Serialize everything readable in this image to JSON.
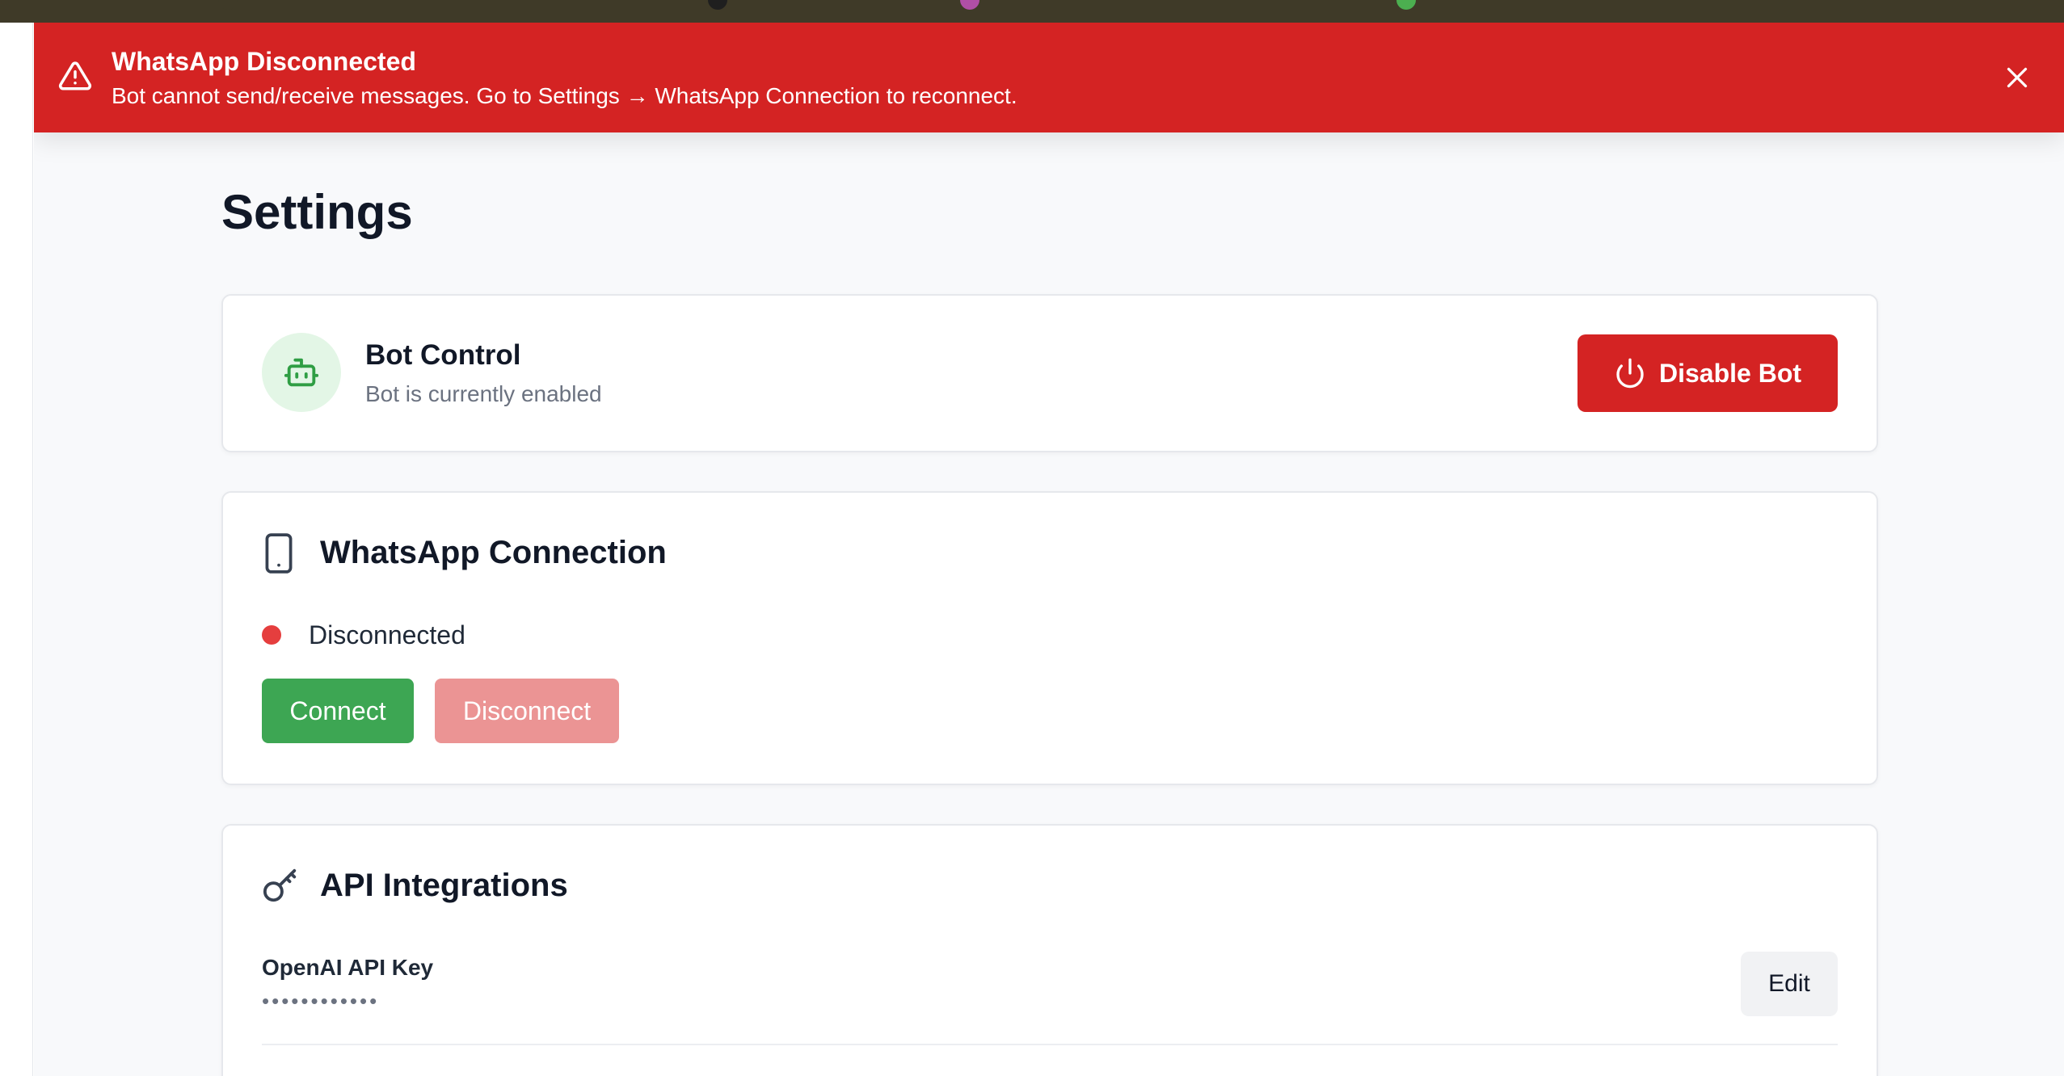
{
  "colors": {
    "alert_bg": "#d42323",
    "danger": "#d42323",
    "success": "#3da653",
    "disabled_danger": "#eb9494",
    "status_disconnected": "#e53e3e",
    "bot_avatar_bg": "#e3f6e6"
  },
  "alert": {
    "icon": "warning-triangle-icon",
    "title": "WhatsApp Disconnected",
    "message": "Bot cannot send/receive messages. Go to Settings → WhatsApp Connection to reconnect.",
    "close_icon": "close-icon"
  },
  "page": {
    "title": "Settings"
  },
  "bot_control": {
    "icon": "robot-icon",
    "title": "Bot Control",
    "status": "Bot is currently enabled",
    "button_icon": "power-icon",
    "button_label": "Disable Bot"
  },
  "whatsapp": {
    "icon": "smartphone-icon",
    "title": "WhatsApp Connection",
    "status": "Disconnected",
    "connect_label": "Connect",
    "disconnect_label": "Disconnect"
  },
  "api": {
    "icon": "key-icon",
    "title": "API Integrations",
    "fields": [
      {
        "label": "OpenAI API Key",
        "value": "••••••••••••",
        "edit_label": "Edit"
      }
    ]
  }
}
